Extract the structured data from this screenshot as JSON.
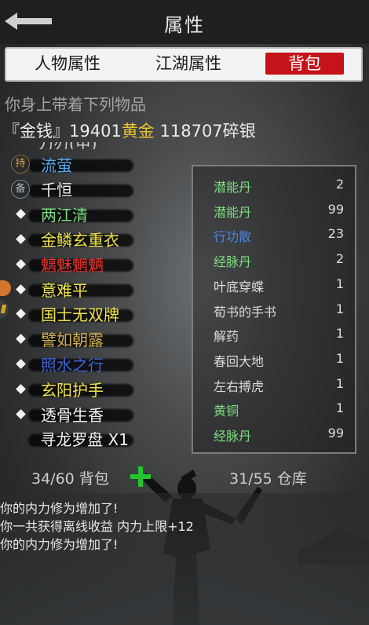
{
  "header": {
    "title": "属性"
  },
  "tabs": [
    {
      "label": "人物属性"
    },
    {
      "label": "江湖属性"
    },
    {
      "label": "背包",
      "active": true
    }
  ],
  "subtitle": "你身上带着下列物品",
  "money": {
    "prefix": "『金钱』",
    "gold_amount": "19401",
    "gold_label": "黄金",
    "silver_amount": "118707",
    "silver_label": "碎银"
  },
  "equipped_items": [
    {
      "marker": "badge",
      "badge": "持",
      "name": "流萤",
      "color": "#5aa7ee"
    },
    {
      "marker": "badge",
      "badge": "备",
      "name": "千恒",
      "color": "#f0f0f0"
    },
    {
      "marker": "diamond",
      "name": "两江清",
      "color": "#7dde7d"
    },
    {
      "marker": "diamond",
      "name": "金鳞玄重衣",
      "color": "#f0e24a"
    },
    {
      "marker": "diamond",
      "name": "魑魅魍魉",
      "color": "#e8322d"
    },
    {
      "marker": "diamond",
      "name": "意难平",
      "color": "#f0e24a"
    },
    {
      "marker": "diamond",
      "name": "国士无双牌",
      "color": "#f0e24a"
    },
    {
      "marker": "diamond",
      "name": "譬如朝露",
      "color": "#cfae4e"
    },
    {
      "marker": "diamond",
      "name": "照水之行",
      "color": "#3e63d6"
    },
    {
      "marker": "diamond",
      "name": "玄阳护手",
      "color": "#f0e24a"
    },
    {
      "marker": "diamond",
      "name": "透骨生香",
      "color": "#f0f0f0"
    },
    {
      "marker": "none",
      "name": "寻龙罗盘 X1",
      "color": "#f0f0f0"
    }
  ],
  "inventory": [
    {
      "name": "潜能丹",
      "qty": "2",
      "color": "#7dde7d"
    },
    {
      "name": "潜能丹",
      "qty": "99",
      "color": "#7dde7d"
    },
    {
      "name": "行功散",
      "qty": "23",
      "color": "#4a86e6"
    },
    {
      "name": "经脉丹",
      "qty": "2",
      "color": "#7dde7d"
    },
    {
      "name": "叶底穿蝶",
      "qty": "1",
      "color": "#dcdcdc"
    },
    {
      "name": "荀书的手书",
      "qty": "1",
      "color": "#dcdcdc"
    },
    {
      "name": "解药",
      "qty": "1",
      "color": "#dcdcdc"
    },
    {
      "name": "春回大地",
      "qty": "1",
      "color": "#dcdcdc"
    },
    {
      "name": "左右搏虎",
      "qty": "1",
      "color": "#dcdcdc"
    },
    {
      "name": "黄铜",
      "qty": "1",
      "color": "#7dde7d"
    },
    {
      "name": "经脉丹",
      "qty": "99",
      "color": "#7dde7d"
    }
  ],
  "footer": {
    "bag_count": "34/60 背包",
    "store_count": "31/55 仓库"
  },
  "log": [
    "你的内力修为增加了!",
    "你一共获得离线收益 内力上限+12",
    "你的内力修为增加了!"
  ],
  "colors": {
    "active_tab": "#c4141a",
    "gold_text": "#e6c532",
    "add_icon": "#21c62e"
  }
}
